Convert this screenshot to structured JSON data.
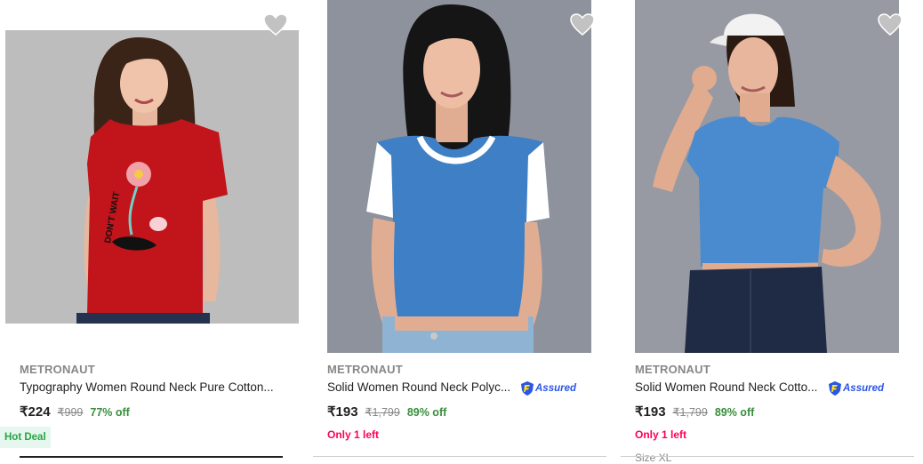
{
  "products": [
    {
      "brand": "METRONAUT",
      "title": "Typography Women Round Neck Pure Cotton...",
      "price": "₹224",
      "mrp": "₹999",
      "discount": "77% off",
      "badge": "Hot Deal",
      "assured": false,
      "image": {
        "tshirt_color": "#c2141b",
        "bg": "#bdbdbd",
        "print_text": "DON'T WAIT UNTIL IT'S TOO LATE"
      }
    },
    {
      "brand": "METRONAUT",
      "title": "Solid Women Round Neck Polyc...",
      "price": "₹193",
      "mrp": "₹1,799",
      "discount": "89% off",
      "stock": "Only 1 left",
      "assured": true,
      "assured_label": "Assured",
      "image": {
        "tshirt_color": "#3f7fc5",
        "sleeve_color": "#ffffff",
        "bg": "#8d929c"
      }
    },
    {
      "brand": "METRONAUT",
      "title": "Solid Women Round Neck Cotto...",
      "price": "₹193",
      "mrp": "₹1,799",
      "discount": "89% off",
      "stock": "Only 1 left",
      "size_peek": "Size XL",
      "assured": true,
      "assured_label": "Assured",
      "image": {
        "tshirt_color": "#4a8bd0",
        "bg": "#979aa3"
      }
    }
  ],
  "colors": {
    "discount": "#388e3c",
    "stock_alert": "#ff0058",
    "assured": "#2a55e5",
    "hot_deal_bg": "#e5f7ee",
    "hot_deal_text": "#26a541"
  },
  "icons": {
    "wishlist": "heart-icon",
    "assured": "assured-shield-icon"
  }
}
